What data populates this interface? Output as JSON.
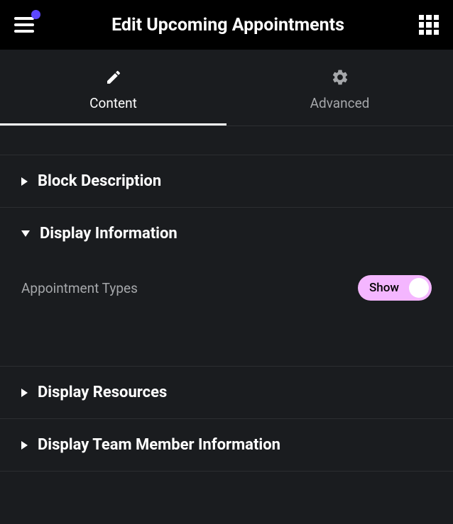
{
  "topbar": {
    "title": "Edit Upcoming Appointments"
  },
  "tabs": {
    "content_label": "Content",
    "advanced_label": "Advanced"
  },
  "sections": {
    "block_description": {
      "title": "Block Description"
    },
    "display_information": {
      "title": "Display Information",
      "rows": {
        "appointment_types": {
          "label": "Appointment Types",
          "toggle_label": "Show"
        }
      }
    },
    "display_resources": {
      "title": "Display Resources"
    },
    "display_team_member": {
      "title": "Display Team Member Information"
    }
  }
}
